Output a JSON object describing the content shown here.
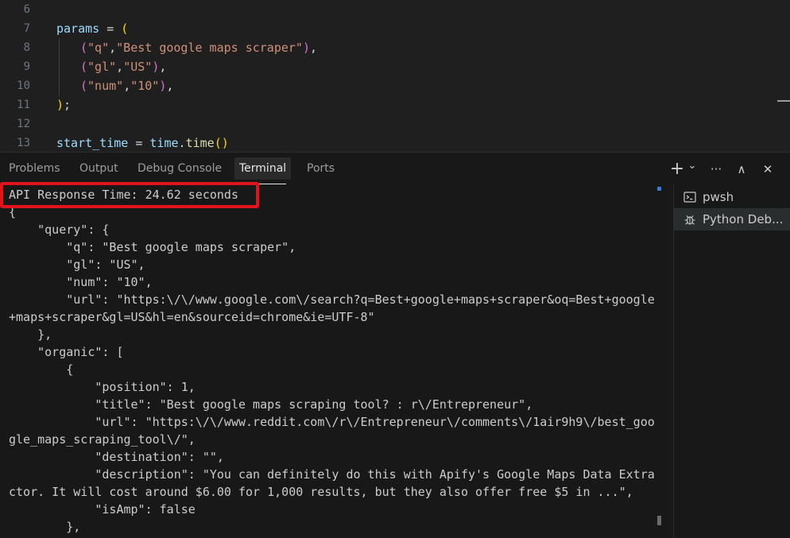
{
  "editor": {
    "lines": [
      {
        "num": "6"
      },
      {
        "num": "7"
      },
      {
        "num": "8"
      },
      {
        "num": "9"
      },
      {
        "num": "10"
      },
      {
        "num": "11"
      },
      {
        "num": "12"
      },
      {
        "num": "13"
      }
    ],
    "code": {
      "l7_var": "params",
      "l7_rest": " = ",
      "l7_open": "(",
      "l8_open": "(",
      "l8_s1": "\"q\"",
      "l8_comma": ",",
      "l8_s2": "\"Best google maps scraper\"",
      "l8_close": ")",
      "l8_tail": ",",
      "l9_open": "(",
      "l9_s1": "\"gl\"",
      "l9_comma": ",",
      "l9_s2": "\"US\"",
      "l9_close": ")",
      "l9_tail": ",",
      "l10_open": "(",
      "l10_s1": "\"num\"",
      "l10_comma": ",",
      "l10_s2": "\"10\"",
      "l10_close": ")",
      "l10_tail": ",",
      "l11_close": ")",
      "l11_tail": ";",
      "l13_var": "start_time",
      "l13_eq": " = ",
      "l13_obj": "time",
      "l13_dot": ".",
      "l13_fn": "time",
      "l13_paren": "()"
    }
  },
  "panel": {
    "tabs": [
      "Problems",
      "Output",
      "Debug Console",
      "Terminal",
      "Ports"
    ],
    "active_tab": "Terminal",
    "actions": {
      "add": "+",
      "dropdown": "⌄",
      "more": "···",
      "maximize": "∧",
      "close": "✕"
    },
    "terminals": [
      {
        "label": "pwsh",
        "icon": "terminal-icon"
      },
      {
        "label": "Python Deb...",
        "icon": "debug-icon"
      }
    ]
  },
  "terminal": {
    "lines": [
      "API Response Time: 24.62 seconds",
      "{",
      "    \"query\": {",
      "        \"q\": \"Best google maps scraper\",",
      "        \"gl\": \"US\",",
      "        \"num\": \"10\",",
      "        \"url\": \"https:\\/\\/www.google.com\\/search?q=Best+google+maps+scraper&oq=Best+google",
      "+maps+scraper&gl=US&hl=en&sourceid=chrome&ie=UTF-8\"",
      "    },",
      "    \"organic\": [",
      "        {",
      "            \"position\": 1,",
      "            \"title\": \"Best google maps scraping tool? : r\\/Entrepreneur\",",
      "            \"url\": \"https:\\/\\/www.reddit.com\\/r\\/Entrepreneur\\/comments\\/1air9h9\\/best_goo",
      "gle_maps_scraping_tool\\/\",",
      "            \"destination\": \"\",",
      "            \"description\": \"You can definitely do this with Apify's Google Maps Data Extra",
      "ctor. It will cost around $6.00 for 1,000 results, but they also offer free $5 in ...\",",
      "            \"isAmp\": false",
      "        },"
    ]
  }
}
